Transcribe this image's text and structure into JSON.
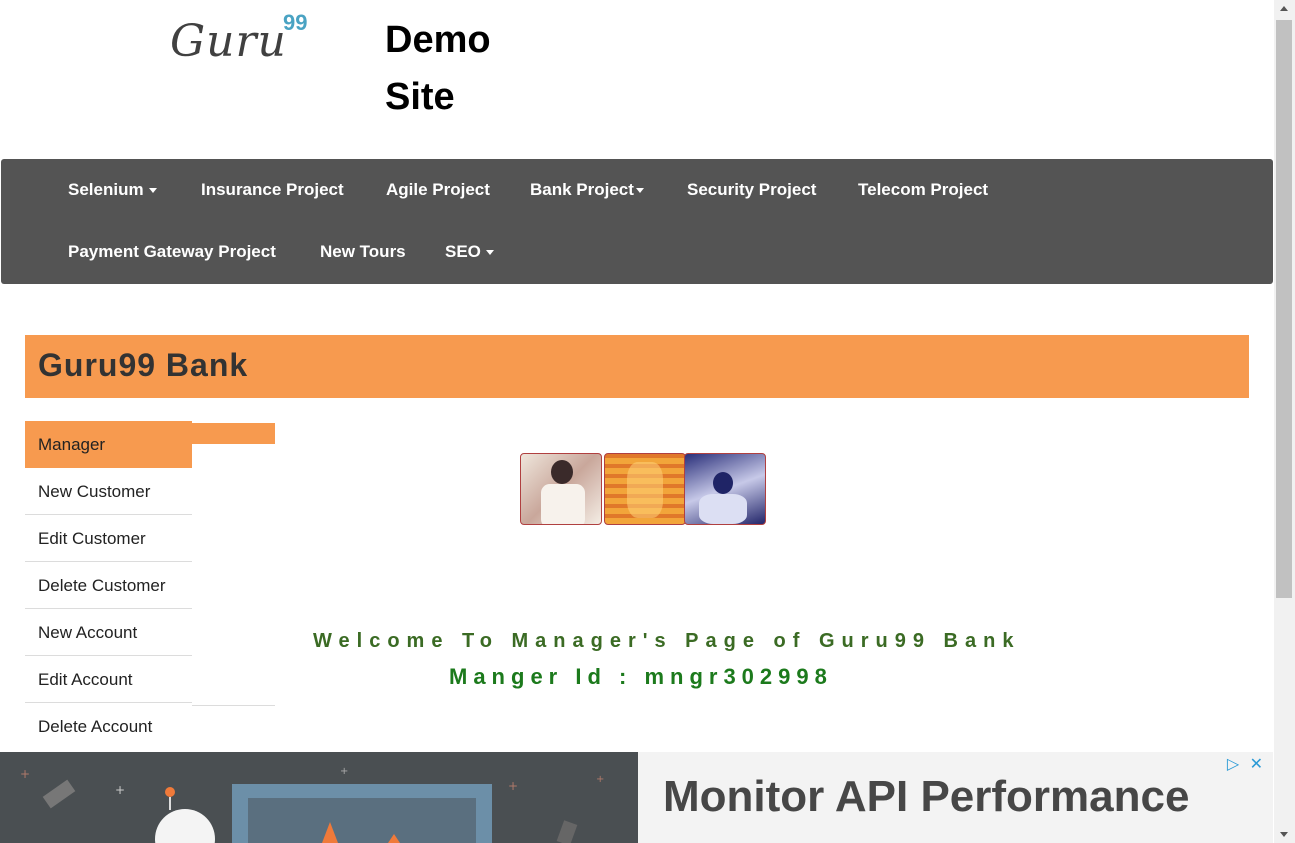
{
  "header": {
    "logo_word": "Guru",
    "logo_sup": "99",
    "site_title": "Demo Site"
  },
  "nav": {
    "row1": [
      {
        "label": "Selenium",
        "dropdown": true
      },
      {
        "label": "Insurance Project",
        "dropdown": false
      },
      {
        "label": "Agile Project",
        "dropdown": false
      },
      {
        "label": "Bank Project",
        "dropdown": true
      },
      {
        "label": "Security Project",
        "dropdown": false
      },
      {
        "label": "Telecom Project",
        "dropdown": false
      }
    ],
    "row2": [
      {
        "label": "Payment Gateway Project",
        "dropdown": false
      },
      {
        "label": "New Tours",
        "dropdown": false
      },
      {
        "label": "SEO",
        "dropdown": true
      }
    ]
  },
  "bank": {
    "title": "Guru99 Bank"
  },
  "sidebar": {
    "items": [
      {
        "label": "Manager",
        "active": true
      },
      {
        "label": "New Customer"
      },
      {
        "label": "Edit Customer"
      },
      {
        "label": "Delete Customer"
      },
      {
        "label": "New Account"
      },
      {
        "label": "Edit Account"
      },
      {
        "label": "Delete Account"
      }
    ]
  },
  "main": {
    "welcome": "Welcome To Manager's Page of Guru99 Bank",
    "manager_id": "Manger Id : mngr302998"
  },
  "ad": {
    "headline": "Monitor API Performance",
    "icons": [
      "adchoices-icon",
      "close-icon"
    ]
  },
  "colors": {
    "accent_orange": "#f79a4f",
    "nav_bg": "#545454",
    "welcome_green": "#3b6b24",
    "id_green": "#1c7a1c"
  }
}
